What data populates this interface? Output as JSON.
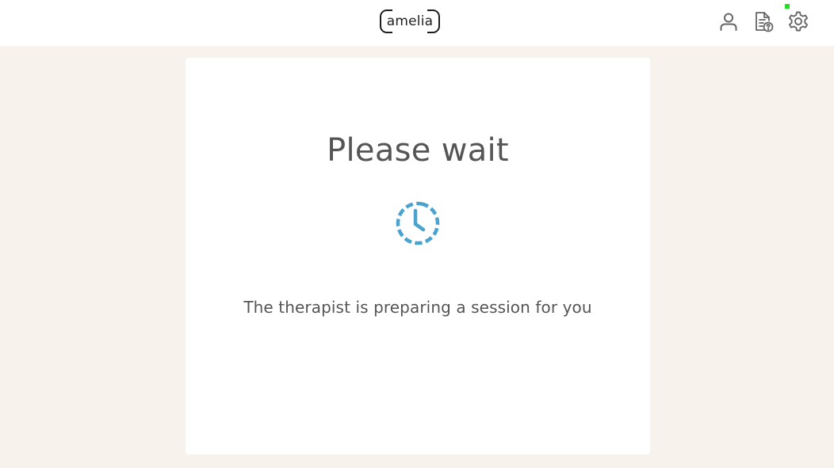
{
  "header": {
    "logo_text": "amelia",
    "icons": [
      "user-icon",
      "help-document-icon",
      "gear-icon"
    ],
    "status_color": "#22dd22"
  },
  "main": {
    "title": "Please wait",
    "spinner_icon": "clock-loading-icon",
    "accent_color": "#4aa3cf",
    "message": "The therapist is preparing a session for you"
  }
}
